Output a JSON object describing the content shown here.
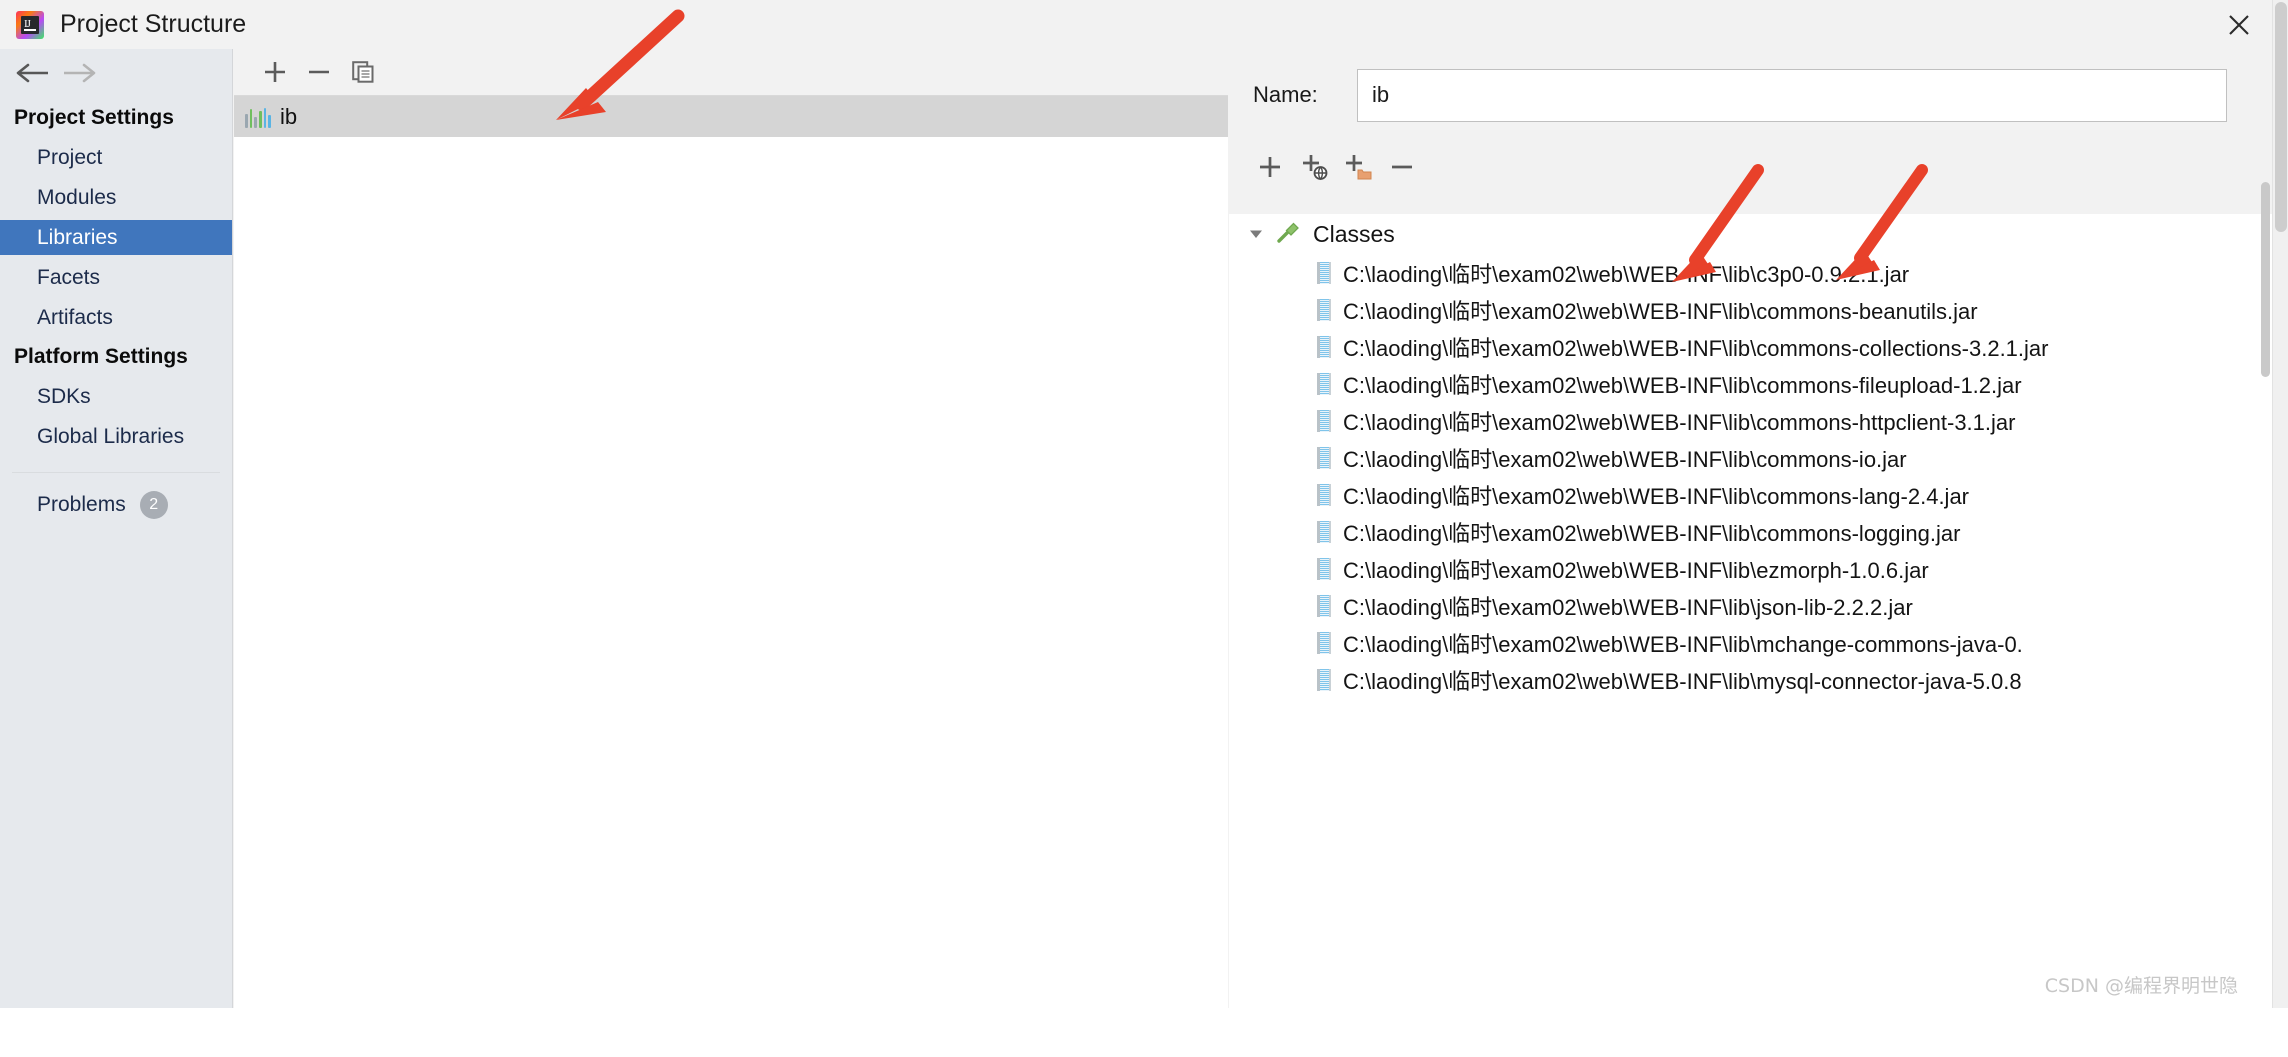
{
  "window": {
    "title": "Project Structure",
    "app_icon": "intellij-idea-icon",
    "close_icon": "close-icon"
  },
  "navigation": {
    "back_icon": "arrow-left-icon",
    "forward_icon": "arrow-right-icon"
  },
  "sidebar": {
    "project_settings_title": "Project Settings",
    "project_settings_items": [
      {
        "label": "Project",
        "selected": false
      },
      {
        "label": "Modules",
        "selected": false
      },
      {
        "label": "Libraries",
        "selected": true
      },
      {
        "label": "Facets",
        "selected": false
      },
      {
        "label": "Artifacts",
        "selected": false
      }
    ],
    "platform_settings_title": "Platform Settings",
    "platform_settings_items": [
      {
        "label": "SDKs",
        "selected": false
      },
      {
        "label": "Global Libraries",
        "selected": false
      }
    ],
    "problems": {
      "label": "Problems",
      "count": "2"
    },
    "selected_color": "#4076bd",
    "background_color": "#e6e9ed"
  },
  "middle_pane": {
    "toolbar": [
      {
        "name": "add-library-button",
        "icon": "plus-icon"
      },
      {
        "name": "remove-library-button",
        "icon": "minus-icon"
      },
      {
        "name": "copy-library-button",
        "icon": "copy-icon"
      }
    ],
    "library": {
      "name": "ib",
      "icon": "library-bars-icon",
      "selected": true
    }
  },
  "right_pane": {
    "name_label": "Name:",
    "name_value": "ib",
    "name_placeholder": "",
    "toolbar": [
      {
        "name": "add-root-button",
        "icon": "plus-icon"
      },
      {
        "name": "attach-url-button",
        "icon": "plus-globe-icon"
      },
      {
        "name": "attach-directory-button",
        "icon": "plus-folder-icon"
      },
      {
        "name": "remove-root-button",
        "icon": "minus-icon"
      }
    ],
    "tree": {
      "root_label": "Classes",
      "root_icon": "hammer-icon",
      "expander_icon": "triangle-down-icon",
      "expanded": true,
      "entries": [
        "C:\\laoding\\临时\\exam02\\web\\WEB-INF\\lib\\c3p0-0.9.2.1.jar",
        "C:\\laoding\\临时\\exam02\\web\\WEB-INF\\lib\\commons-beanutils.jar",
        "C:\\laoding\\临时\\exam02\\web\\WEB-INF\\lib\\commons-collections-3.2.1.jar",
        "C:\\laoding\\临时\\exam02\\web\\WEB-INF\\lib\\commons-fileupload-1.2.jar",
        "C:\\laoding\\临时\\exam02\\web\\WEB-INF\\lib\\commons-httpclient-3.1.jar",
        "C:\\laoding\\临时\\exam02\\web\\WEB-INF\\lib\\commons-io.jar",
        "C:\\laoding\\临时\\exam02\\web\\WEB-INF\\lib\\commons-lang-2.4.jar",
        "C:\\laoding\\临时\\exam02\\web\\WEB-INF\\lib\\commons-logging.jar",
        "C:\\laoding\\临时\\exam02\\web\\WEB-INF\\lib\\ezmorph-1.0.6.jar",
        "C:\\laoding\\临时\\exam02\\web\\WEB-INF\\lib\\json-lib-2.2.2.jar",
        "C:\\laoding\\临时\\exam02\\web\\WEB-INF\\lib\\mchange-commons-java-0.",
        "C:\\laoding\\临时\\exam02\\web\\WEB-INF\\lib\\mysql-connector-java-5.0.8"
      ]
    }
  },
  "annotations": {
    "arrow_color": "#e8412a",
    "arrows": [
      {
        "name": "arrow-to-library-item"
      },
      {
        "name": "arrow-to-jar-path-left"
      },
      {
        "name": "arrow-to-jar-path-right"
      }
    ]
  },
  "watermark": {
    "text": "CSDN @编程界明世隐"
  }
}
